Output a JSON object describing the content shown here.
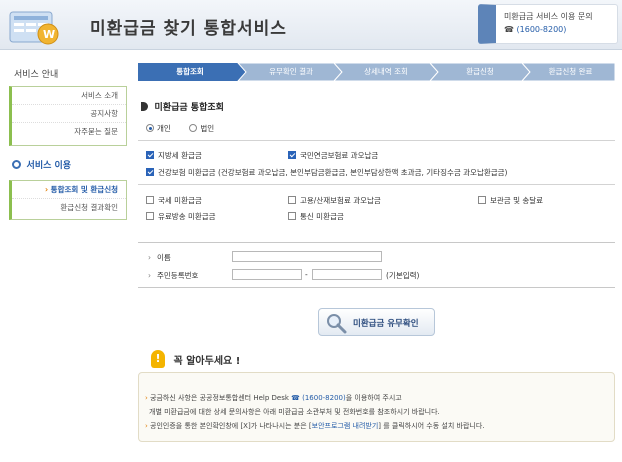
{
  "header": {
    "title": "미환급금 찾기 통합서비스",
    "contact_line1": "미환급금 서비스 이용 문의",
    "contact_phone": "(1600-8200)"
  },
  "sidebar": {
    "guide_title": "서비스 안내",
    "guide_items": [
      "서비스 소개",
      "공지사항",
      "자주묻는 질문"
    ],
    "use_title": "서비스 이용",
    "use_items": [
      {
        "label": "통합조회 및 환급신청",
        "active": true
      },
      {
        "label": "환급신청 결과확인",
        "active": false
      }
    ]
  },
  "steps": [
    "통합조회",
    "유무확인 결과",
    "상세내역 조회",
    "환급신청",
    "환급신청 완료"
  ],
  "inquiry": {
    "title": "미환급금 통합조회",
    "radio_personal": "개인",
    "radio_corporate": "법인",
    "checked_items": [
      "지방세 환급금",
      "국민연금보험료 과오납금",
      "건강보험 미환급금 (건강보험료 과오납금, 본인부담금환급금, 본인부담상한액 초과금, 기타징수금 과오납환급금)"
    ],
    "unchecked_items": [
      "국세 미환급금",
      "고용/산재보험료 과오납금",
      "보관금 및 송달료",
      "유료방송 미환급금",
      "통신 미환급금"
    ]
  },
  "form": {
    "name_label": "이름",
    "rrn_label": "주민등록번호",
    "rrn_dash": "-",
    "rrn_hint": "(기본입력)"
  },
  "check_button_label": "미환급금 유무확인",
  "notice": {
    "title": "꼭 알아두세요 !",
    "line1_pre": "궁금하신 사항은 공공정보통합센터 Help Desk",
    "line1_phone": "(1600-8200)",
    "line1_post": "을 이용하여 주시고",
    "line2": "개별 미환급금에 대한 상세 문의사항은 아래 미환급금 소관부처 및 전화번호를 참조하시기 바랍니다.",
    "line3_pre": "공인인증을 통한 본인확인창에 [X]가 나타나시는 분은 [",
    "line3_link": "보안프로그램 내려받기",
    "line3_post": "] 를 클릭하시어 수동 설치 바랍니다."
  },
  "colors": {
    "step_active": "#3b6fb4",
    "step_inactive": "#9fb7d4",
    "sidebar_accent": "#8cbf4f",
    "link_blue": "#245ca8"
  }
}
